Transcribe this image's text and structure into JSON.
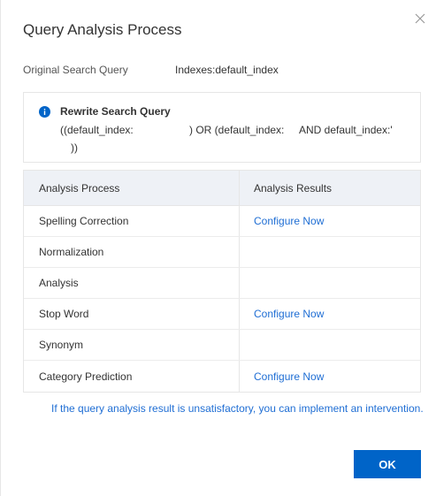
{
  "dialog": {
    "title": "Query Analysis Process",
    "close_icon": "close-icon"
  },
  "meta": {
    "label": "Original Search Query",
    "value": "Indexes:default_index"
  },
  "rewrite": {
    "icon": "info-icon",
    "title": "Rewrite Search Query",
    "line1_part1": "((default_index:",
    "line1_part2": ") OR (default_index:",
    "line1_part3": "AND default_index:'",
    "line2": "))"
  },
  "table": {
    "headers": [
      "Analysis Process",
      "Analysis Results"
    ],
    "rows": [
      {
        "process": "Spelling Correction",
        "result": "Configure Now"
      },
      {
        "process": "Normalization",
        "result": ""
      },
      {
        "process": "Analysis",
        "result": ""
      },
      {
        "process": "Stop Word",
        "result": "Configure Now"
      },
      {
        "process": "Synonym",
        "result": ""
      },
      {
        "process": "Category Prediction",
        "result": "Configure Now"
      }
    ]
  },
  "hint": "If the query analysis result is unsatisfactory, you can implement an intervention.",
  "footer": {
    "ok_label": "OK"
  },
  "colors": {
    "accent": "#0064c8",
    "link": "#1f6ed4",
    "header_bg": "#eef1f6"
  }
}
